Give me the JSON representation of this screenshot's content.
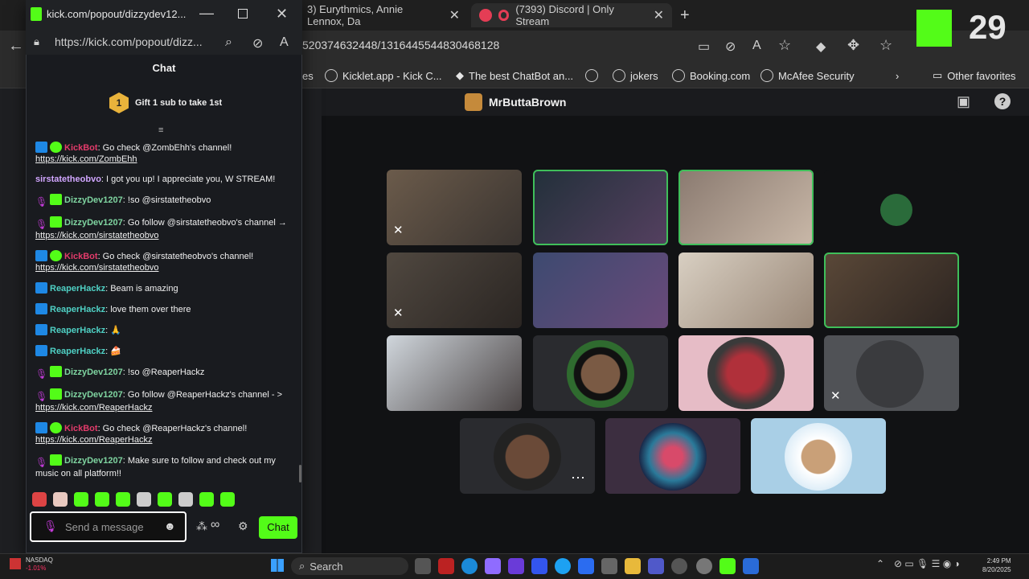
{
  "background_browser": {
    "tabs": [
      {
        "label": "3) Eurythmics, Annie Lennox, Da"
      },
      {
        "label": "(7393) Discord | Only Stream"
      }
    ],
    "url": "520374632448/1316445544830468128",
    "favorites": [
      "es",
      "Kicklet.app - Kick C...",
      "The best ChatBot an...",
      "jokers",
      "Booking.com",
      "McAfee Security"
    ],
    "other_favorites": "Other favorites"
  },
  "discord": {
    "call_title": "MrButtaBrown"
  },
  "popup": {
    "window_title": "kick.com/popout/dizzydev12...",
    "url": "https://kick.com/popout/dizz...",
    "chat_header": "Chat",
    "gift_text": "Gift 1 sub to take 1st",
    "gift_rank": "1",
    "messages": [
      {
        "user": "KickBot",
        "color": "#e33b6b",
        "badges": [
          "bot",
          "verified"
        ],
        "text": ": Go check @ZombEhh's channel!",
        "link": "https://kick.com/ZombEhh"
      },
      {
        "user": "sirstatetheobvo",
        "color": "#d1a6ff",
        "badges": [],
        "text": ": I got you up! I appreciate you, W STREAM!",
        "link": ""
      },
      {
        "user": "DizzyDev1207",
        "color": "#7fd4a0",
        "badges": [
          "mic",
          "sub"
        ],
        "text": ": !so @sirstatetheobvo",
        "link": ""
      },
      {
        "user": "DizzyDev1207",
        "color": "#7fd4a0",
        "badges": [
          "mic",
          "sub"
        ],
        "text": ": Go follow @sirstatetheobvo's channel → ",
        "link": "https://kick.com/sirstatetheobvo"
      },
      {
        "user": "KickBot",
        "color": "#e33b6b",
        "badges": [
          "bot",
          "verified"
        ],
        "text": ": Go check @sirstatetheobvo's channel!",
        "link": "https://kick.com/sirstatetheobvo"
      },
      {
        "user": "ReaperHackz",
        "color": "#4fd1c5",
        "badges": [
          "bot"
        ],
        "text": ": Beam is amazing",
        "link": ""
      },
      {
        "user": "ReaperHackz",
        "color": "#4fd1c5",
        "badges": [
          "bot"
        ],
        "text": ": love them over there",
        "link": ""
      },
      {
        "user": "ReaperHackz",
        "color": "#4fd1c5",
        "badges": [
          "bot"
        ],
        "text": ": 🙏",
        "link": ""
      },
      {
        "user": "ReaperHackz",
        "color": "#4fd1c5",
        "badges": [
          "bot"
        ],
        "text": ": 🍰",
        "link": ""
      },
      {
        "user": "DizzyDev1207",
        "color": "#7fd4a0",
        "badges": [
          "mic",
          "sub"
        ],
        "text": ": !so @ReaperHackz",
        "link": ""
      },
      {
        "user": "DizzyDev1207",
        "color": "#7fd4a0",
        "badges": [
          "mic",
          "sub"
        ],
        "text": ": Go follow @ReaperHackz's channel - > ",
        "link": "https://kick.com/ReaperHackz"
      },
      {
        "user": "KickBot",
        "color": "#e33b6b",
        "badges": [
          "bot",
          "verified"
        ],
        "text": ": Go check @ReaperHackz's channel!",
        "link": "https://kick.com/ReaperHackz"
      },
      {
        "user": "DizzyDev1207",
        "color": "#7fd4a0",
        "badges": [
          "mic",
          "sub"
        ],
        "text": ": Make sure to follow and check out my music on all platform!!",
        "link": ""
      }
    ],
    "input_placeholder": "Send a message",
    "chat_button": "Chat"
  },
  "overlay": {
    "count": "29"
  },
  "taskbar": {
    "search": "Search",
    "time": "2:49 PM",
    "date": "8/20/2025",
    "ticker": "NASDAQ",
    "ticker_change": "-1.01%"
  },
  "colors": {
    "kick_green": "#53fc18",
    "speaking": "#3fbf5a"
  }
}
